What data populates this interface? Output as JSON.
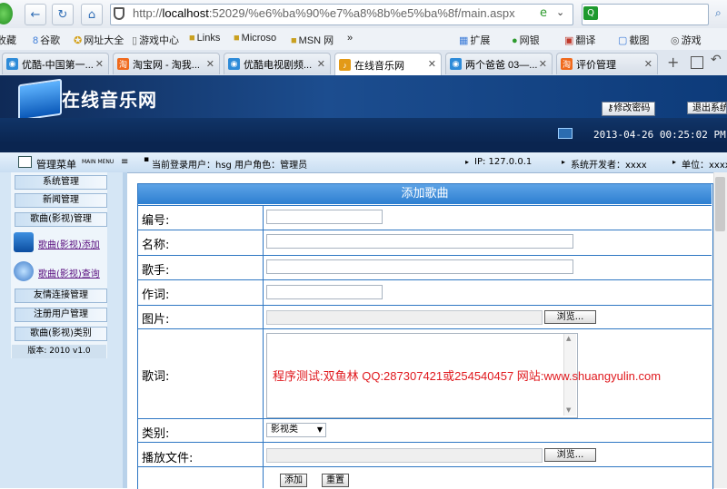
{
  "browser": {
    "url_prefix": "http://",
    "url_host": "localhost",
    "url_rest": ":52029/%e6%ba%90%e7%a8%8b%e5%ba%8f/main.aspx",
    "bookmarks": [
      "收藏",
      "谷歌",
      "网址大全",
      "游戏中心",
      "Links",
      "Microso",
      "MSN 网",
      "»",
      "扩展",
      "网银",
      "翻译",
      "截图",
      "游戏"
    ],
    "tabs": [
      "优酷-中国第一...",
      "淘宝网 - 淘我...",
      "优酷电视剧频...",
      "在线音乐网",
      "两个爸爸 03—...",
      "评价管理"
    ]
  },
  "header": {
    "site_title": "在线音乐网",
    "change_password": "修改密码",
    "logout": "退出系统",
    "datetime": "2013-04-26 00:25:02 PM"
  },
  "infobar": {
    "menu_title": "管理菜单",
    "menu_sub": "MAIN MENU",
    "user": "当前登录用户：hsg  用户角色：管理员",
    "ip": "IP: 127.0.0.1",
    "developer": "系统开发者：xxxx",
    "unit": "单位：xxxx"
  },
  "sidebar": {
    "items": [
      "系统管理",
      "新闻管理",
      "歌曲(影视)管理"
    ],
    "links": [
      "歌曲(影视)添加",
      "歌曲(影视)查询"
    ],
    "items2": [
      "友情连接管理",
      "注册用户管理",
      "歌曲(影视)类别"
    ],
    "version": "版本: 2010 v1.0"
  },
  "form": {
    "title": "添加歌曲",
    "labels": {
      "id": "编号:",
      "name": "名称:",
      "singer": "歌手:",
      "lyricist": "作词:",
      "image": "图片:",
      "lyrics": "歌词:",
      "category": "类别:",
      "play_file": "播放文件:"
    },
    "browse": "浏览...",
    "lyrics_note": "程序测试:双鱼林 QQ:287307421或254540457 网站:www.shuangyulin.com",
    "category_value": "影视类",
    "add": "添加",
    "reset": "重置"
  }
}
